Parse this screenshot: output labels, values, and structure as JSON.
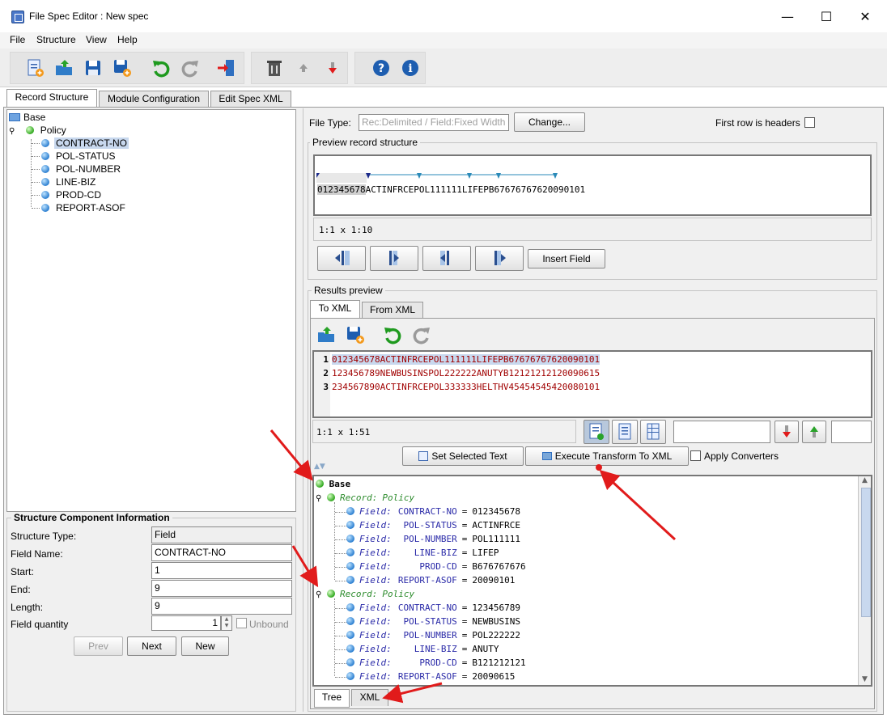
{
  "window": {
    "title": "File Spec Editor : New spec",
    "controls": [
      "—",
      "☐",
      "✕"
    ]
  },
  "menu": [
    "File",
    "Structure",
    "View",
    "Help"
  ],
  "toolbar": {
    "icons": [
      "new-spec-icon",
      "open-icon",
      "save-icon",
      "save-as-icon",
      "undo-icon",
      "redo-icon",
      "exit-icon",
      "delete-icon",
      "move-up-icon",
      "move-down-icon",
      "help-icon",
      "info-icon"
    ]
  },
  "tabs": [
    "Record Structure",
    "Module Configuration",
    "Edit Spec XML"
  ],
  "tree": {
    "root": "Base",
    "record": "Policy",
    "fields": [
      "CONTRACT-NO",
      "POL-STATUS",
      "POL-NUMBER",
      "LINE-BIZ",
      "PROD-CD",
      "REPORT-ASOF"
    ],
    "selected": "CONTRACT-NO"
  },
  "component_info": {
    "title": "Structure Component Information",
    "rows": [
      {
        "label": "Structure Type:",
        "value": "Field"
      },
      {
        "label": "Field Name:",
        "value": "CONTRACT-NO"
      },
      {
        "label": "Start:",
        "value": "1"
      },
      {
        "label": "End:",
        "value": "9"
      },
      {
        "label": "Length:",
        "value": "9"
      }
    ],
    "quantity_label": "Field quantity",
    "quantity_value": "1",
    "unbound_label": "Unbound",
    "buttons": {
      "prev": "Prev",
      "next": "Next",
      "new": "New"
    }
  },
  "file_type": {
    "label": "File Type:",
    "placeholder": "Rec:Delimited / Field:Fixed Width",
    "change_button": "Change...",
    "first_row_label": "First row is headers"
  },
  "preview": {
    "title": "Preview record structure",
    "highlight": "012345678",
    "rest": "ACTINFRCEPOL111111LIFEPB67676767620090101",
    "position": "1:1 x 1:10",
    "insert_field": "Insert Field"
  },
  "results": {
    "title": "Results preview",
    "tabs": [
      "To XML",
      "From XML"
    ],
    "lines": [
      {
        "num": "1",
        "text": "012345678ACTINFRCEPOL111111LIFEPB67676767620090101"
      },
      {
        "num": "2",
        "text": "123456789NEWBUSINSPOL222222ANUTYB12121212120090615"
      },
      {
        "num": "3",
        "text": "234567890ACTINFRCEPOL333333HELTHV45454545420080101"
      }
    ],
    "position": "1:1 x 1:51",
    "set_selected": "Set Selected Text",
    "execute": "Execute Transform To XML",
    "apply_converters": "Apply Converters"
  },
  "xml_tree": {
    "root": "Base",
    "record_kw": "Record:",
    "field_kw": "Field:",
    "records": [
      {
        "name": "Policy",
        "fields": [
          {
            "name": "CONTRACT-NO",
            "eq": "=",
            "value": "012345678"
          },
          {
            "name": "POL-STATUS",
            "eq": "=",
            "value": "ACTINFRCE"
          },
          {
            "name": "POL-NUMBER",
            "eq": "=",
            "value": "POL111111"
          },
          {
            "name": "LINE-BIZ",
            "eq": "=",
            "value": "LIFEP"
          },
          {
            "name": "PROD-CD",
            "eq": "=",
            "value": "B676767676"
          },
          {
            "name": "REPORT-ASOF",
            "eq": "=",
            "value": "20090101"
          }
        ]
      },
      {
        "name": "Policy",
        "fields": [
          {
            "name": "CONTRACT-NO",
            "eq": "=",
            "value": "123456789"
          },
          {
            "name": "POL-STATUS",
            "eq": "=",
            "value": "NEWBUSINS"
          },
          {
            "name": "POL-NUMBER",
            "eq": "=",
            "value": "POL222222"
          },
          {
            "name": "LINE-BIZ",
            "eq": "=",
            "value": "ANUTY"
          },
          {
            "name": "PROD-CD",
            "eq": "=",
            "value": "B121212121"
          },
          {
            "name": "REPORT-ASOF",
            "eq": "=",
            "value": "20090615"
          }
        ]
      }
    ],
    "bottom_tabs": [
      "Tree",
      "XML"
    ]
  },
  "colors": {
    "accent_red": "#e11b1b",
    "selection": "#c8d8ee",
    "record_green": "#2a8a2a",
    "field_blue": "#2a2aa8"
  }
}
